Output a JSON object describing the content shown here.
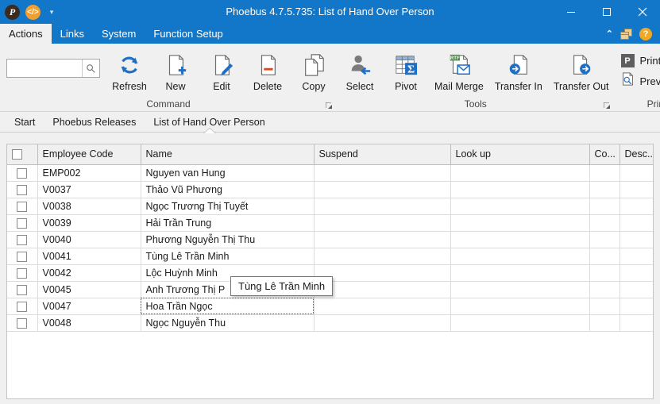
{
  "window": {
    "title": "Phoebus 4.7.5.735: List of Hand Over Person",
    "quick_access": [
      {
        "name": "phoebus-logo-icon",
        "glyph": "P"
      },
      {
        "name": "code-icon",
        "glyph": "</>"
      },
      {
        "name": "customize-quick-access-icon",
        "glyph": "▾"
      }
    ],
    "controls": {
      "minimize": "–",
      "maximize": "□",
      "close": "✕"
    }
  },
  "menubar": {
    "tabs": [
      {
        "label": "Actions",
        "active": true
      },
      {
        "label": "Links",
        "active": false
      },
      {
        "label": "System",
        "active": false
      },
      {
        "label": "Function Setup",
        "active": false
      }
    ],
    "right": {
      "collapse_ribbon": "⌃",
      "windows_icon": "cascade-windows-icon",
      "help": "?"
    }
  },
  "ribbon": {
    "search": {
      "value": "",
      "placeholder": ""
    },
    "groups": [
      {
        "label": "Command",
        "buttons": [
          {
            "label": "Refresh",
            "icon": "refresh-icon"
          },
          {
            "label": "New",
            "icon": "new-document-icon"
          },
          {
            "label": "Edit",
            "icon": "edit-pencil-icon"
          },
          {
            "label": "Delete",
            "icon": "delete-document-icon"
          },
          {
            "label": "Copy",
            "icon": "copy-icon"
          }
        ]
      },
      {
        "label": "Tools",
        "buttons": [
          {
            "label": "Select",
            "icon": "select-person-icon"
          },
          {
            "label": "Pivot",
            "icon": "pivot-table-icon"
          },
          {
            "label": "Mail Merge",
            "icon": "mail-merge-icon"
          },
          {
            "label": "Transfer In",
            "icon": "transfer-in-icon"
          },
          {
            "label": "Transfer Out",
            "icon": "transfer-out-icon"
          }
        ]
      },
      {
        "label": "Print",
        "buttons": [
          {
            "label": "Print",
            "icon": "print-icon"
          },
          {
            "label": "Preview",
            "icon": "preview-icon"
          }
        ]
      }
    ]
  },
  "breadcrumb": {
    "items": [
      {
        "label": "Start",
        "active": false
      },
      {
        "label": "Phoebus Releases",
        "active": false
      },
      {
        "label": "List of Hand Over Person",
        "active": true
      }
    ]
  },
  "grid": {
    "columns": [
      "Employee Code",
      "Name",
      "Suspend",
      "Look up",
      "Co...",
      "Desc..."
    ],
    "rows": [
      {
        "code": "EMP002",
        "name": "Nguyen van Hung",
        "suspend": "",
        "lookup": "",
        "co": "",
        "desc": "",
        "selected": false
      },
      {
        "code": "V0037",
        "name": "Thảo  Vũ Phương",
        "suspend": "",
        "lookup": "",
        "co": "",
        "desc": "",
        "selected": false
      },
      {
        "code": "V0038",
        "name": "Ngọc  Trương Thị Tuyết",
        "suspend": "",
        "lookup": "",
        "co": "",
        "desc": "",
        "selected": false
      },
      {
        "code": "V0039",
        "name": "Hải  Trần Trung",
        "suspend": "",
        "lookup": "",
        "co": "",
        "desc": "",
        "selected": false
      },
      {
        "code": "V0040",
        "name": "Phương  Nguyễn Thị Thu",
        "suspend": "",
        "lookup": "",
        "co": "",
        "desc": "",
        "selected": false
      },
      {
        "code": "V0041",
        "name": "Tùng  Lê Trần Minh",
        "suspend": "",
        "lookup": "",
        "co": "",
        "desc": "",
        "selected": false
      },
      {
        "code": "V0042",
        "name": "Lộc  Huỳnh Minh",
        "suspend": "",
        "lookup": "",
        "co": "",
        "desc": "",
        "selected": false
      },
      {
        "code": "V0045",
        "name": "Anh  Trương Thị P",
        "suspend": "",
        "lookup": "",
        "co": "",
        "desc": "",
        "selected": false
      },
      {
        "code": "V0047",
        "name": "Hoa  Trần Ngọc",
        "suspend": "",
        "lookup": "",
        "co": "",
        "desc": "",
        "selected": true
      },
      {
        "code": "V0048",
        "name": "Ngọc  Nguyễn Thu",
        "suspend": "",
        "lookup": "",
        "co": "",
        "desc": "",
        "selected": false
      }
    ]
  },
  "tooltip": {
    "text": "Tùng  Lê Trần Minh"
  },
  "colors": {
    "titlebar": "#1277c8",
    "ribbon": "#f0f0f0",
    "accent_blue": "#1f6fc4",
    "help_orange": "#f2a725"
  }
}
